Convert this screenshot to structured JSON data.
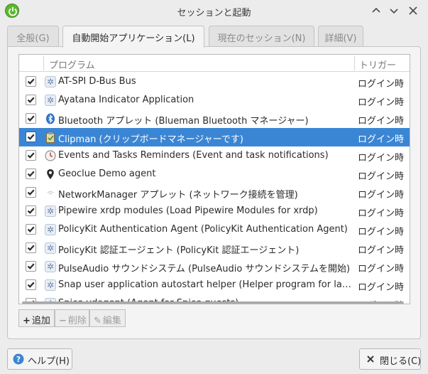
{
  "window": {
    "title": "セッションと起動"
  },
  "tabs": [
    {
      "label": "全般(G)"
    },
    {
      "label": "自動開始アプリケーション(L)"
    },
    {
      "label": "現在のセッション(N)"
    },
    {
      "label": "詳細(V)"
    }
  ],
  "columns": {
    "program": "プログラム",
    "trigger": "トリガー"
  },
  "rows": [
    {
      "name": "AT-SPI D-Bus Bus",
      "trigger": "ログイン時",
      "icon": "gear-icon",
      "checked": true
    },
    {
      "name": "Ayatana Indicator Application",
      "trigger": "ログイン時",
      "icon": "gear-icon",
      "checked": true
    },
    {
      "name": "Bluetooth アプレット (Blueman Bluetooth マネージャー)",
      "trigger": "ログイン時",
      "icon": "bluetooth-icon",
      "checked": true
    },
    {
      "name": "Clipman (クリップボードマネージャーです)",
      "trigger": "ログイン時",
      "icon": "clipboard-icon",
      "checked": true
    },
    {
      "name": "Events and Tasks Reminders (Event and task notifications)",
      "trigger": "ログイン時",
      "icon": "clock-icon",
      "checked": true
    },
    {
      "name": "Geoclue Demo agent",
      "trigger": "ログイン時",
      "icon": "location-pin-icon",
      "checked": true
    },
    {
      "name": "NetworkManager アプレット (ネットワーク接続を管理)",
      "trigger": "ログイン時",
      "icon": "wifi-icon",
      "checked": true
    },
    {
      "name": "Pipewire xrdp modules (Load Pipewire Modules for xrdp)",
      "trigger": "ログイン時",
      "icon": "gear-icon",
      "checked": true
    },
    {
      "name": "PolicyKit Authentication Agent (PolicyKit Authentication Agent)",
      "trigger": "ログイン時",
      "icon": "gear-icon",
      "checked": true
    },
    {
      "name": "PolicyKit 認証エージェント (PolicyKit 認証エージェント)",
      "trigger": "ログイン時",
      "icon": "gear-icon",
      "checked": true
    },
    {
      "name": "PulseAudio サウンドシステム (PulseAudio サウンドシステムを開始)",
      "trigger": "ログイン時",
      "icon": "gear-icon",
      "checked": true
    },
    {
      "name": "Snap user application autostart helper (Helper program for launching snap applications)",
      "trigger": "ログイン時",
      "icon": "gear-icon",
      "checked": true
    },
    {
      "name": "Spice vdagent (Agent for Spice guests)",
      "trigger": "ログイン時",
      "icon": "gear-icon",
      "checked": true
    }
  ],
  "toolbar": {
    "add": "追加",
    "remove": "削除",
    "edit": "編集"
  },
  "footer": {
    "help": "ヘルプ(H)",
    "close": "閉じる(C)"
  },
  "colors": {
    "selection": "#3b86d4",
    "power_icon": "#5cb82e"
  }
}
